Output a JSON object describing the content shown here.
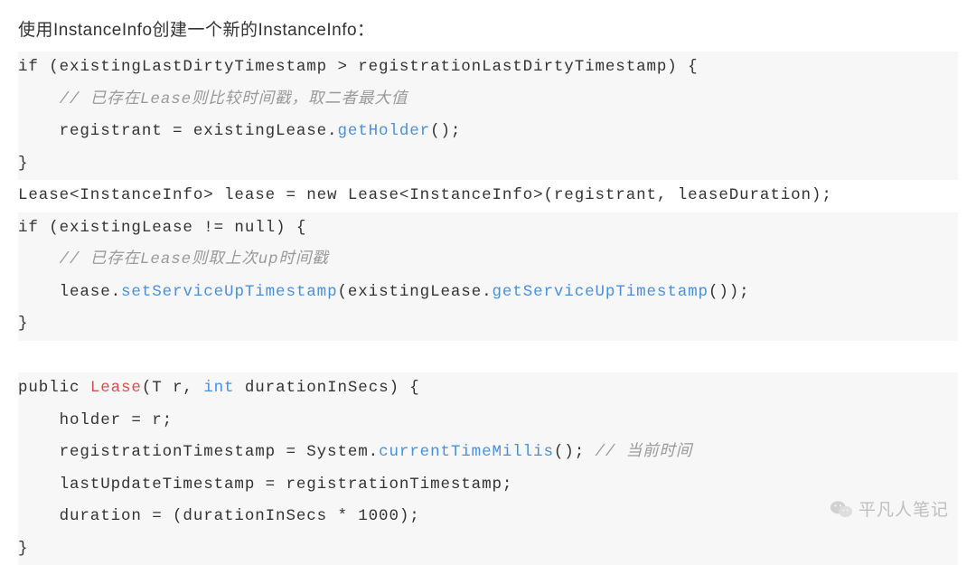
{
  "heading": "使用InstanceInfo创建一个新的InstanceInfo：",
  "code": {
    "l1a": "if (existingLastDirtyTimestamp > registrationLastDirtyTimestamp) {",
    "l2_indent": "    ",
    "l2_comment": "// 已存在Lease则比较时间戳，取二者最大值",
    "l3a": "    registrant = existingLease.",
    "l3b": "getHolder",
    "l3c": "();",
    "l4": "}",
    "l5": "Lease<InstanceInfo> lease = new Lease<InstanceInfo>(registrant, leaseDuration);",
    "l6": "if (existingLease != null) {",
    "l7_indent": "    ",
    "l7_comment": "// 已存在Lease则取上次up时间戳",
    "l8a": "    lease.",
    "l8b": "setServiceUpTimestamp",
    "l8c": "(existingLease.",
    "l8d": "getServiceUpTimestamp",
    "l8e": "());",
    "l9": "}",
    "l11a": "public ",
    "l11b": "Lease",
    "l11c": "(T r, ",
    "l11d": "int",
    "l11e": " durationInSecs) {",
    "l12": "    holder = r;",
    "l13a": "    registrationTimestamp = System.",
    "l13b": "currentTimeMillis",
    "l13c": "(); ",
    "l13_comment": "// 当前时间",
    "l14": "    lastUpdateTimestamp = registrationTimestamp;",
    "l15": "    duration = (durationInSecs * 1000);",
    "l16": "}"
  },
  "watermark": "平凡人笔记"
}
